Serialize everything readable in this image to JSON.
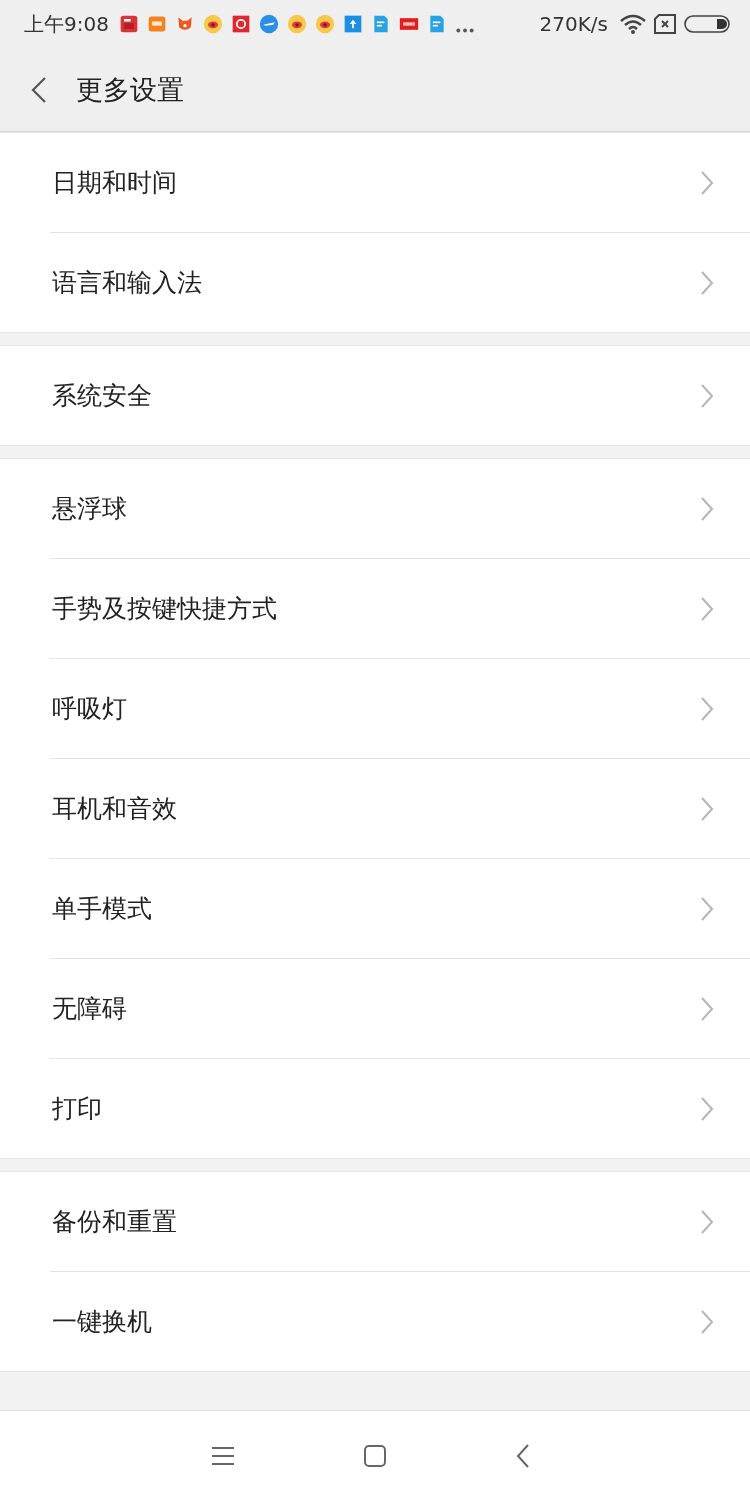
{
  "status_bar": {
    "time": "上午9:08",
    "speed": "270K/s"
  },
  "header": {
    "title": "更多设置"
  },
  "groups": [
    {
      "items": [
        "日期和时间",
        "语言和输入法"
      ]
    },
    {
      "items": [
        "系统安全"
      ]
    },
    {
      "items": [
        "悬浮球",
        "手势及按键快捷方式",
        "呼吸灯",
        "耳机和音效",
        "单手模式",
        "无障碍",
        "打印"
      ]
    },
    {
      "items": [
        "备份和重置",
        "一键换机"
      ]
    }
  ]
}
